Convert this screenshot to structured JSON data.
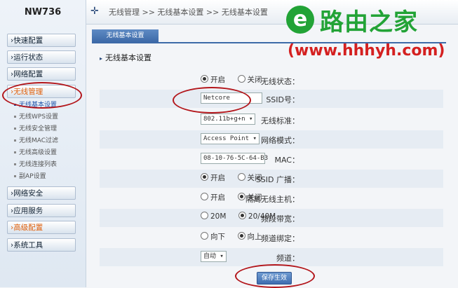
{
  "header": {
    "model": "NW736",
    "breadcrumb": "无线管理 >> 无线基本设置 >> 无线基本设置"
  },
  "watermark": {
    "name": "路由之家",
    "url": "(www.hhhyh.com)",
    "color": "#22a336",
    "url_color": "#d42020"
  },
  "sidebar": {
    "items": [
      {
        "label": "›快速配置"
      },
      {
        "label": "›运行状态"
      },
      {
        "label": "›网络配置"
      },
      {
        "label": "›无线管理"
      },
      {
        "label": "›网络安全"
      },
      {
        "label": "›应用服务"
      },
      {
        "label": "›高级配置"
      },
      {
        "label": "›系统工具"
      }
    ],
    "sub_items": [
      {
        "label": "无线基本设置"
      },
      {
        "label": "无线WPS设置"
      },
      {
        "label": "无线安全管理"
      },
      {
        "label": "无线MAC过滤"
      },
      {
        "label": "无线高级设置"
      },
      {
        "label": "无线连接列表"
      },
      {
        "label": "副AP设置"
      }
    ]
  },
  "main": {
    "tab_label": "无线基本设置",
    "section_title": "无线基本设置",
    "fields": {
      "wireless_status": {
        "label": "无线状态：",
        "opt_on": "开启",
        "opt_off": "关闭"
      },
      "ssid": {
        "label": "SSID号：",
        "value": "Netcore"
      },
      "standard": {
        "label": "无线标准：",
        "value": "802.11b+g+n ▾"
      },
      "mode": {
        "label": "网络模式：",
        "value": "Access Point ▾"
      },
      "mac": {
        "label": "MAC：",
        "value": "08-10-76-5C-64-B3"
      },
      "broadcast": {
        "label": "SSID 广播：",
        "opt_on": "开启",
        "opt_off": "关闭"
      },
      "isolation": {
        "label": "隔离无线主机：",
        "opt_on": "开启",
        "opt_off": "关闭"
      },
      "bandwidth": {
        "label": "频段带宽：",
        "opt_a": "20M",
        "opt_b": "20/40M"
      },
      "channel_dir": {
        "label": "频道绑定：",
        "opt_a": "向下",
        "opt_b": "向上"
      },
      "channel": {
        "label": "频道：",
        "value": "自动            ▾"
      }
    },
    "save_label": "保存生效"
  },
  "colors": {
    "accent": "#3d6aa8",
    "annotation": "#b3161b",
    "active_menu": "#e0600c"
  }
}
